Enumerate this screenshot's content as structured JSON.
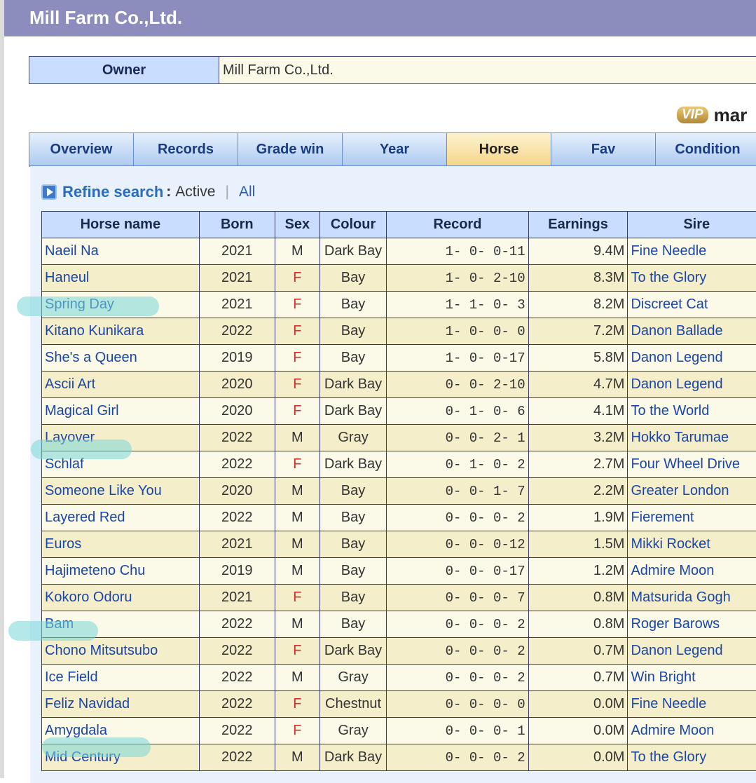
{
  "header": {
    "title": "Mill Farm Co.,Ltd."
  },
  "owner": {
    "label": "Owner",
    "value": "Mill Farm Co.,Ltd."
  },
  "vip": {
    "badge": "VIP",
    "text": "mar"
  },
  "tabs": [
    {
      "label": "Overview",
      "active": false
    },
    {
      "label": "Records",
      "active": false
    },
    {
      "label": "Grade win",
      "active": false
    },
    {
      "label": "Year",
      "active": false
    },
    {
      "label": "Horse",
      "active": true
    },
    {
      "label": "Fav",
      "active": false
    },
    {
      "label": "Condition",
      "active": false
    }
  ],
  "refine": {
    "label": "Refine search",
    "colon": ":",
    "active": "Active",
    "separator": "|",
    "all": "All"
  },
  "table": {
    "headers": [
      "Horse name",
      "Born",
      "Sex",
      "Colour",
      "Record",
      "Earnings",
      "Sire"
    ],
    "rows": [
      {
        "name": "Naeil Na",
        "born": "2021",
        "sex": "M",
        "colour": "Dark Bay",
        "record": "1- 0- 0-11",
        "earnings": "9.4M",
        "sire": "Fine Needle"
      },
      {
        "name": "Haneul",
        "born": "2021",
        "sex": "F",
        "colour": "Bay",
        "record": "1- 0- 2-10",
        "earnings": "8.3M",
        "sire": "To the Glory"
      },
      {
        "name": "Spring Day",
        "born": "2021",
        "sex": "F",
        "colour": "Bay",
        "record": "1- 1- 0- 3",
        "earnings": "8.2M",
        "sire": "Discreet Cat"
      },
      {
        "name": "Kitano Kunikara",
        "born": "2022",
        "sex": "F",
        "colour": "Bay",
        "record": "1- 0- 0- 0",
        "earnings": "7.2M",
        "sire": "Danon Ballade"
      },
      {
        "name": "She's a Queen",
        "born": "2019",
        "sex": "F",
        "colour": "Bay",
        "record": "1- 0- 0-17",
        "earnings": "5.8M",
        "sire": "Danon Legend"
      },
      {
        "name": "Ascii Art",
        "born": "2020",
        "sex": "F",
        "colour": "Dark Bay",
        "record": "0- 0- 2-10",
        "earnings": "4.7M",
        "sire": "Danon Legend"
      },
      {
        "name": "Magical Girl",
        "born": "2020",
        "sex": "F",
        "colour": "Dark Bay",
        "record": "0- 1- 0- 6",
        "earnings": "4.1M",
        "sire": "To the World"
      },
      {
        "name": "Layover",
        "born": "2022",
        "sex": "M",
        "colour": "Gray",
        "record": "0- 0- 2- 1",
        "earnings": "3.2M",
        "sire": "Hokko Tarumae"
      },
      {
        "name": "Schlaf",
        "born": "2022",
        "sex": "F",
        "colour": "Dark Bay",
        "record": "0- 1- 0- 2",
        "earnings": "2.7M",
        "sire": "Four Wheel Drive"
      },
      {
        "name": "Someone Like You",
        "born": "2020",
        "sex": "M",
        "colour": "Bay",
        "record": "0- 0- 1- 7",
        "earnings": "2.2M",
        "sire": "Greater London"
      },
      {
        "name": "Layered Red",
        "born": "2022",
        "sex": "M",
        "colour": "Bay",
        "record": "0- 0- 0- 2",
        "earnings": "1.9M",
        "sire": "Fierement"
      },
      {
        "name": "Euros",
        "born": "2021",
        "sex": "M",
        "colour": "Bay",
        "record": "0- 0- 0-12",
        "earnings": "1.5M",
        "sire": "Mikki Rocket"
      },
      {
        "name": "Hajimeteno Chu",
        "born": "2019",
        "sex": "M",
        "colour": "Bay",
        "record": "0- 0- 0-17",
        "earnings": "1.2M",
        "sire": "Admire Moon"
      },
      {
        "name": "Kokoro Odoru",
        "born": "2021",
        "sex": "F",
        "colour": "Bay",
        "record": "0- 0- 0- 7",
        "earnings": "0.8M",
        "sire": "Matsurida Gogh"
      },
      {
        "name": "Bam",
        "born": "2022",
        "sex": "M",
        "colour": "Bay",
        "record": "0- 0- 0- 2",
        "earnings": "0.8M",
        "sire": "Roger Barows"
      },
      {
        "name": "Chono Mitsutsubo",
        "born": "2022",
        "sex": "F",
        "colour": "Dark Bay",
        "record": "0- 0- 0- 2",
        "earnings": "0.7M",
        "sire": "Danon Legend"
      },
      {
        "name": "Ice Field",
        "born": "2022",
        "sex": "M",
        "colour": "Gray",
        "record": "0- 0- 0- 2",
        "earnings": "0.7M",
        "sire": "Win Bright"
      },
      {
        "name": "Feliz Navidad",
        "born": "2022",
        "sex": "F",
        "colour": "Chestnut",
        "record": "0- 0- 0- 0",
        "earnings": "0.0M",
        "sire": "Fine Needle"
      },
      {
        "name": "Amygdala",
        "born": "2022",
        "sex": "F",
        "colour": "Gray",
        "record": "0- 0- 0- 1",
        "earnings": "0.0M",
        "sire": "Admire Moon"
      },
      {
        "name": "Mid Century",
        "born": "2022",
        "sex": "M",
        "colour": "Dark Bay",
        "record": "0- 0- 0- 2",
        "earnings": "0.0M",
        "sire": "To the Glory"
      }
    ]
  },
  "colors": {
    "header_bg": "#8c8cbd",
    "th_bg": "#c8ddff",
    "row_odd": "#fbf9e8",
    "row_even": "#f5eecb",
    "link": "#1a46a8",
    "female": "#d03030",
    "highlight": "#78d7d7"
  }
}
